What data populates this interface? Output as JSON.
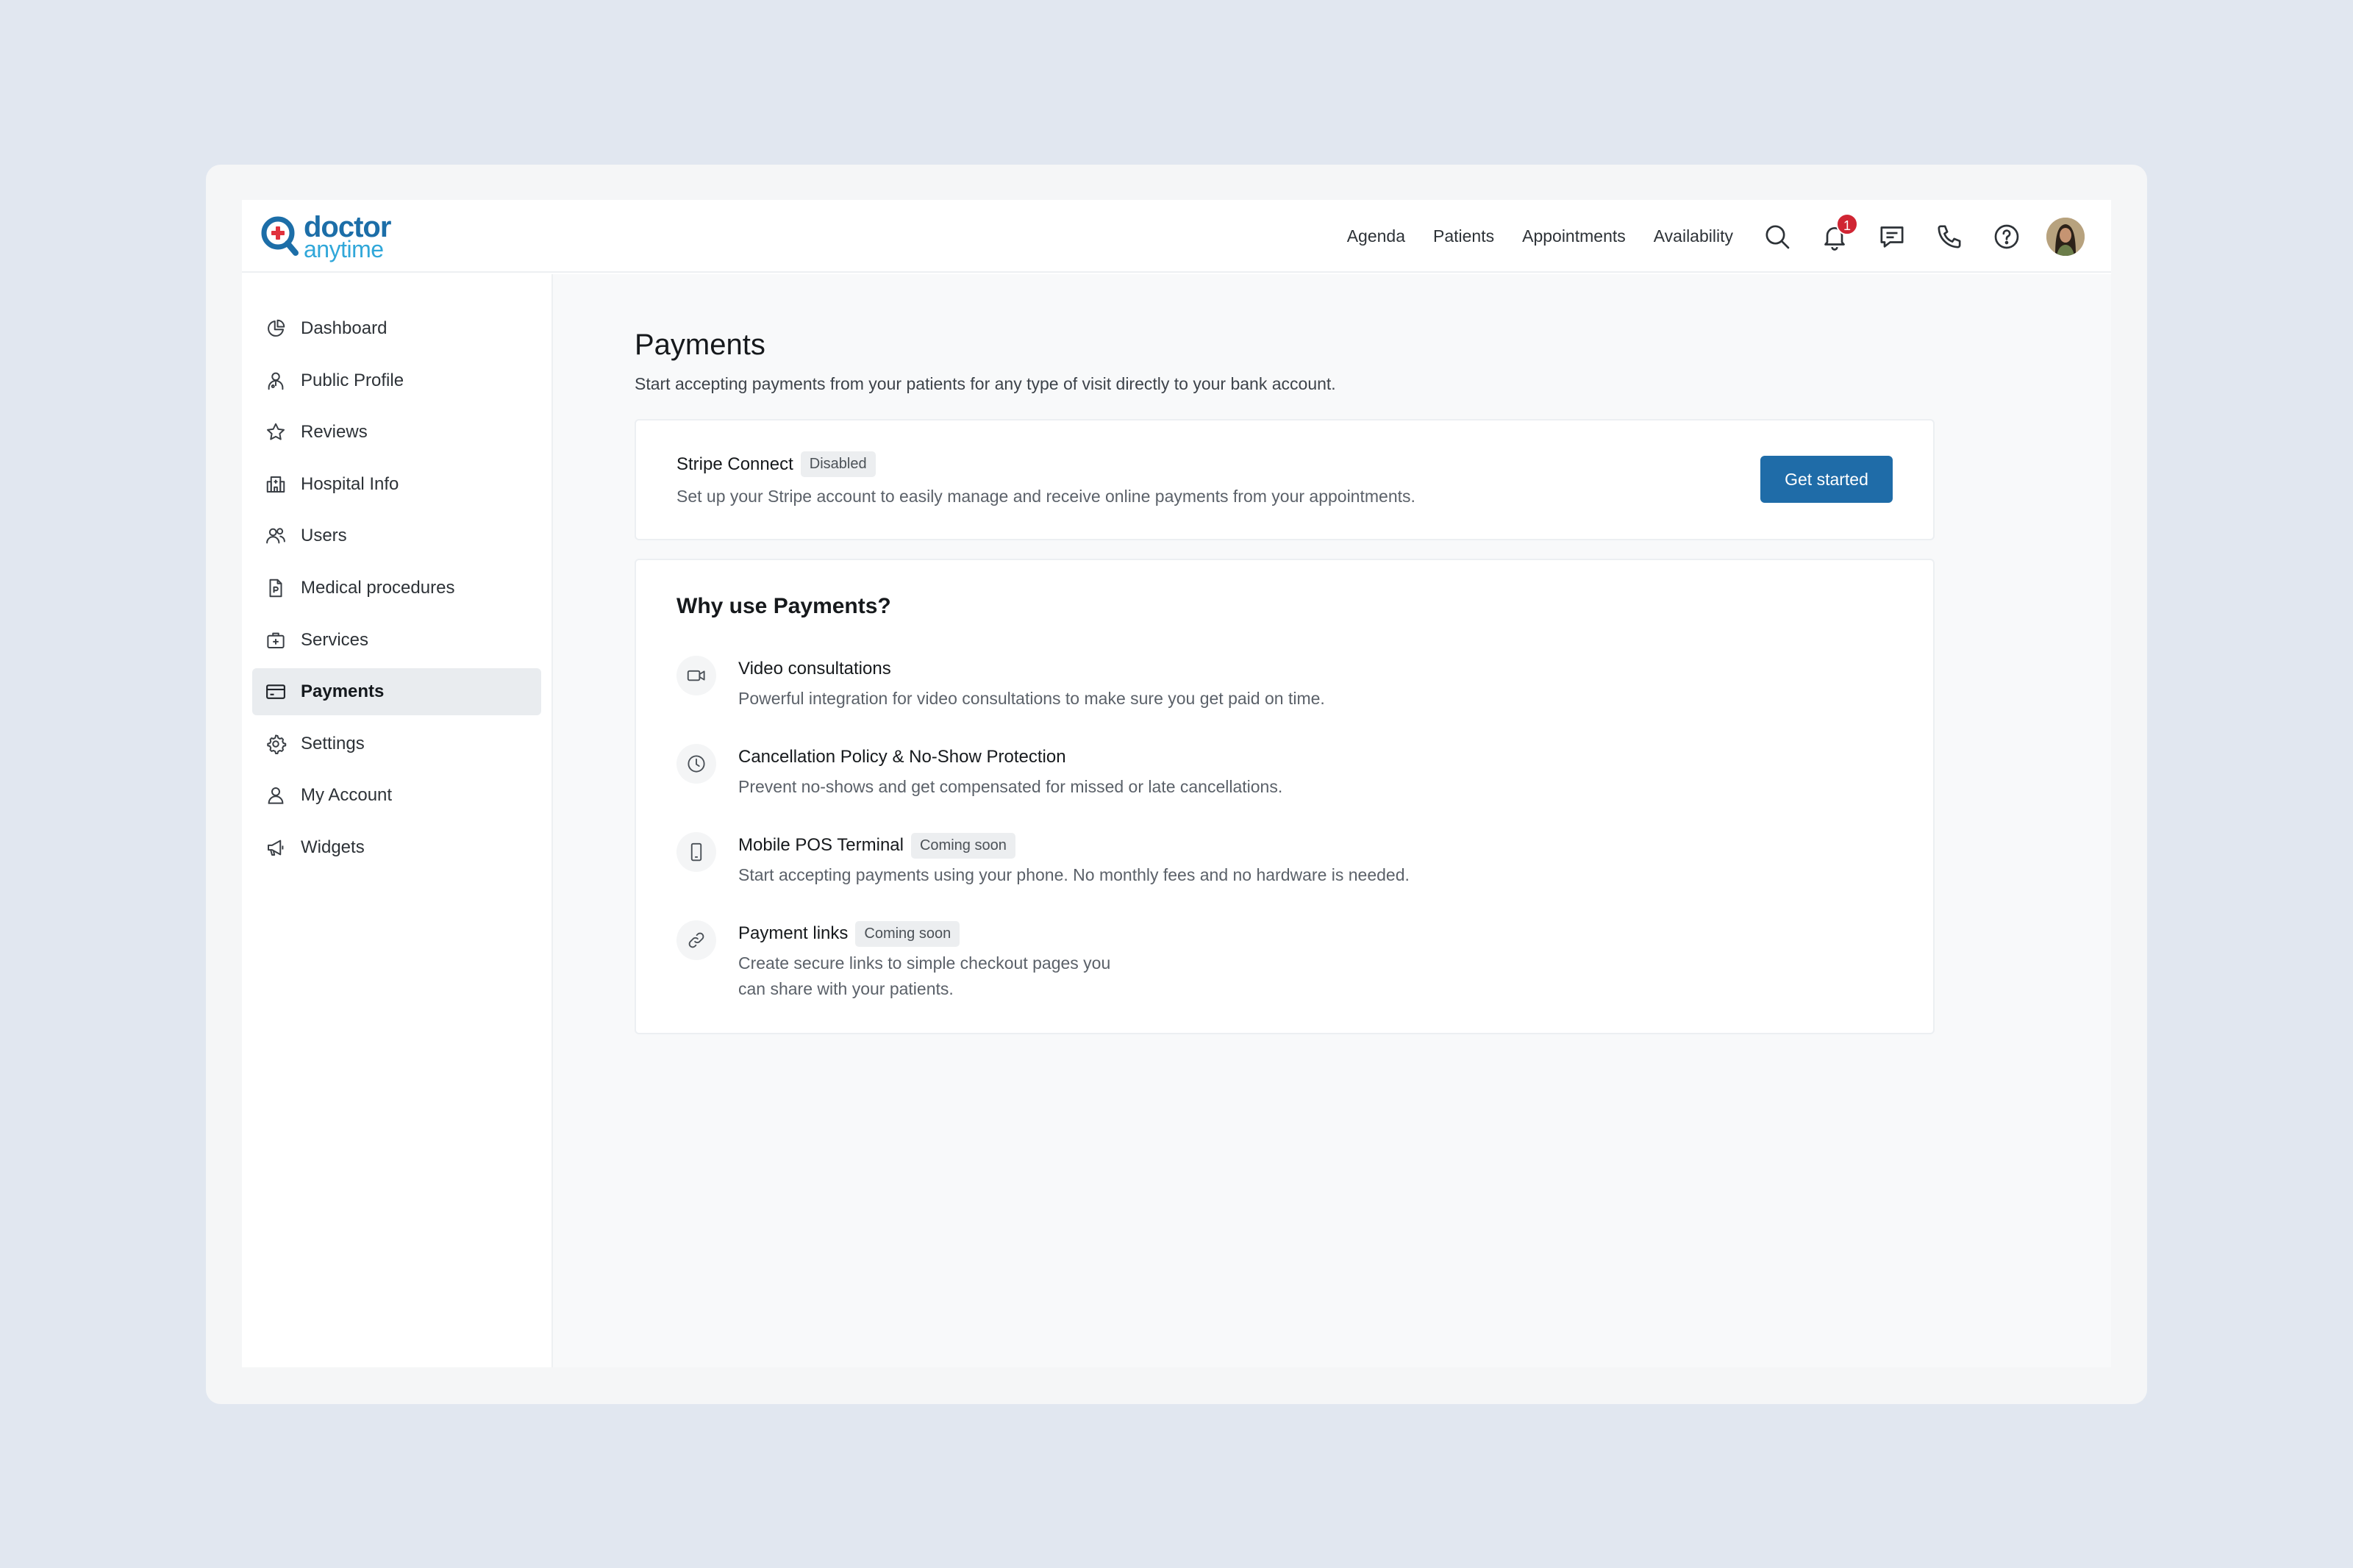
{
  "brand": {
    "line1": "doctor",
    "line2": "anytime",
    "primary_color": "#1c6ea8",
    "accent_color": "#30a7d9"
  },
  "header": {
    "nav": [
      "Agenda",
      "Patients",
      "Appointments",
      "Availability"
    ],
    "notification_count": "1",
    "icons": [
      "search-icon",
      "bell-icon",
      "chat-icon",
      "phone-icon",
      "help-icon"
    ]
  },
  "sidebar": {
    "items": [
      {
        "label": "Dashboard",
        "icon": "pie-chart-icon"
      },
      {
        "label": "Public Profile",
        "icon": "person-badge-icon"
      },
      {
        "label": "Reviews",
        "icon": "star-icon"
      },
      {
        "label": "Hospital Info",
        "icon": "hospital-icon"
      },
      {
        "label": "Users",
        "icon": "users-icon"
      },
      {
        "label": "Medical procedures",
        "icon": "document-icon"
      },
      {
        "label": "Services",
        "icon": "medical-kit-icon"
      },
      {
        "label": "Payments",
        "icon": "credit-card-icon",
        "active": true
      },
      {
        "label": "Settings",
        "icon": "gear-icon"
      },
      {
        "label": "My Account",
        "icon": "user-icon"
      },
      {
        "label": "Widgets",
        "icon": "megaphone-icon"
      }
    ]
  },
  "main": {
    "title": "Payments",
    "subtitle": "Start accepting payments from your patients for any type of visit directly to your bank account.",
    "stripe": {
      "name": "Stripe Connect",
      "status": "Disabled",
      "description": "Set up your Stripe account to easily manage and receive online payments from your appointments.",
      "button": "Get started",
      "button_color": "#1f6ca8"
    },
    "why": {
      "title": "Why use Payments?",
      "features": [
        {
          "title": "Video consultations",
          "tag": "",
          "icon": "video-camera-icon",
          "desc_lines": [
            "Powerful integration for video consultations to make sure you get paid on time."
          ]
        },
        {
          "title": "Cancellation Policy & No-Show Protection",
          "tag": "",
          "icon": "clock-icon",
          "desc_lines": [
            "Prevent no-shows and get compensated for missed or late cancellations."
          ]
        },
        {
          "title": "Mobile POS Terminal",
          "tag": "Coming soon",
          "icon": "mobile-phone-icon",
          "desc_lines": [
            "Start accepting payments using your phone. No monthly fees and no hardware is needed."
          ]
        },
        {
          "title": "Payment links",
          "tag": "Coming soon",
          "icon": "link-icon",
          "desc_lines": [
            "Create secure links to simple checkout pages you",
            "can share with your patients."
          ]
        }
      ]
    }
  }
}
